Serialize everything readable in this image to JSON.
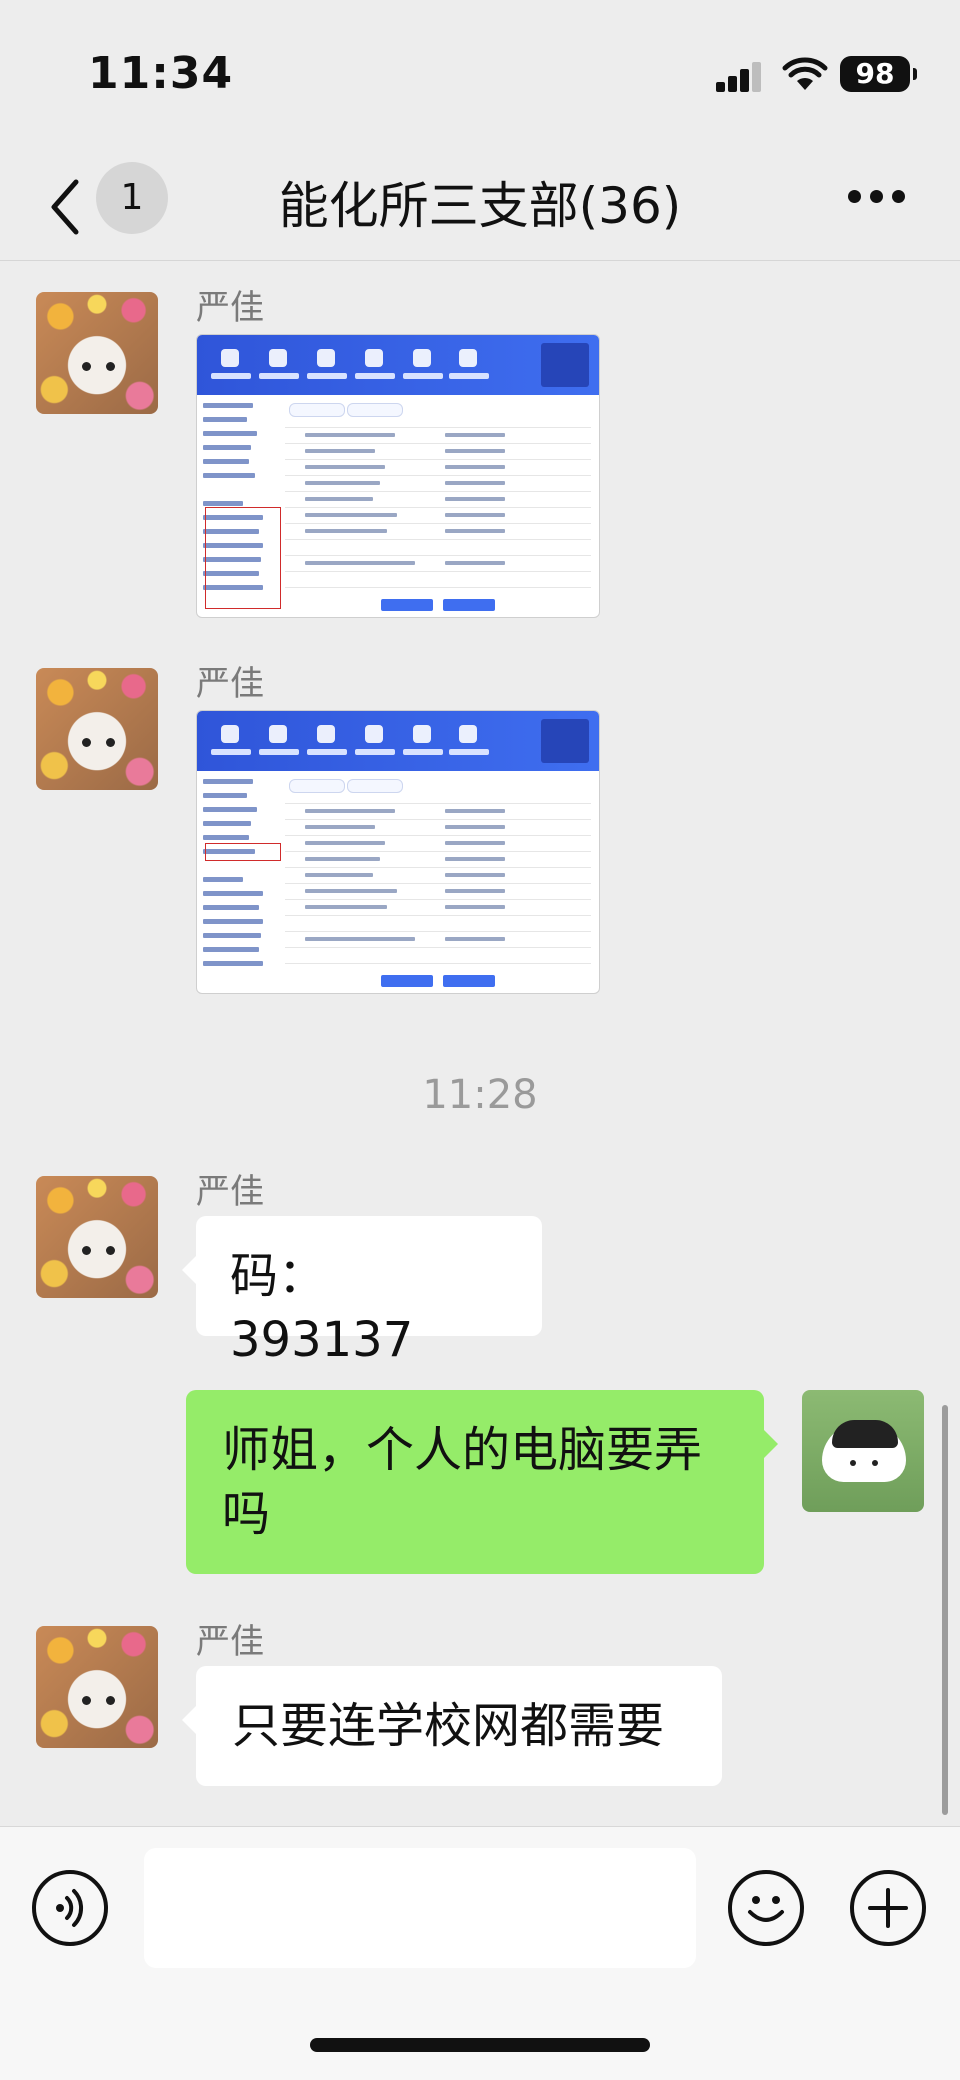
{
  "status_bar": {
    "time": "11:34",
    "battery": "98"
  },
  "nav": {
    "unread_count": "1",
    "title": "能化所三支部(36)"
  },
  "messages": [
    {
      "type": "image",
      "sender": "严佳"
    },
    {
      "type": "image",
      "sender": "严佳"
    },
    {
      "type": "timestamp",
      "text": "11:28"
    },
    {
      "type": "text",
      "sender": "严佳",
      "text": "码：393137"
    },
    {
      "type": "text",
      "sender": "me",
      "text": "师姐，个人的电脑要弄吗"
    },
    {
      "type": "text",
      "sender": "严佳",
      "text": "只要连学校网都需要"
    }
  ],
  "icons": {
    "back": "chevron-left-icon",
    "more": "more-dots-icon",
    "voice": "voice-icon",
    "emoji": "emoji-icon",
    "plus": "plus-icon"
  },
  "colors": {
    "sent_bubble": "#95ec69",
    "received_bubble": "#ffffff",
    "background": "#ededed"
  }
}
